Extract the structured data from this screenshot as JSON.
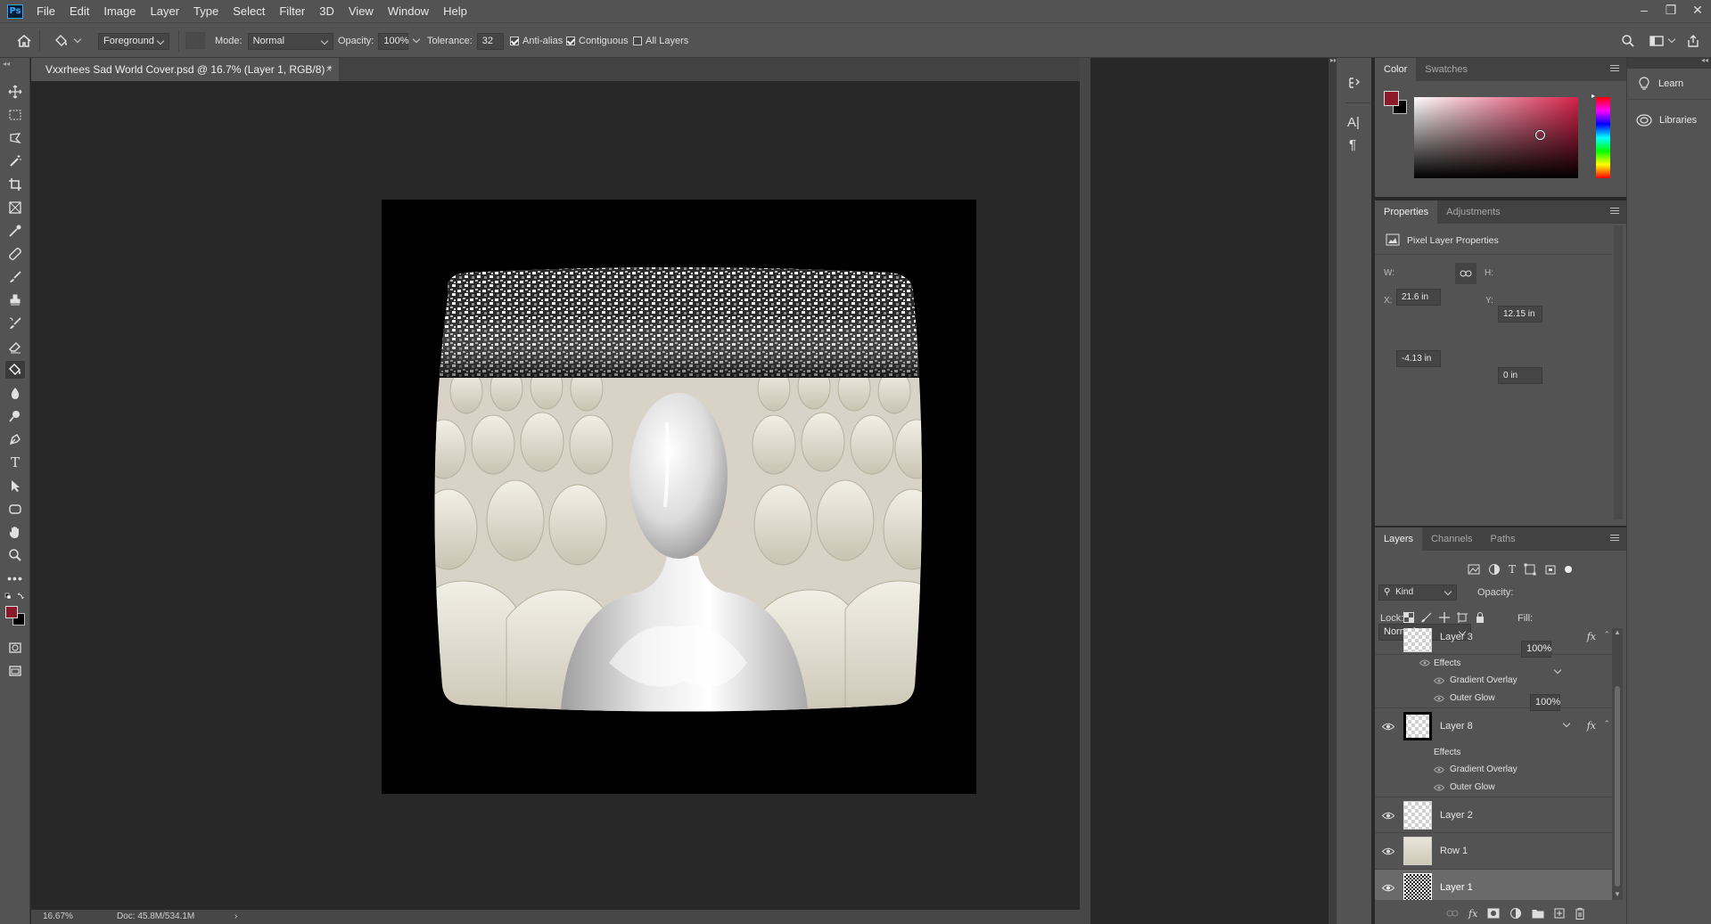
{
  "app": {
    "logo": "Ps"
  },
  "menu": [
    "File",
    "Edit",
    "Image",
    "Layer",
    "Type",
    "Select",
    "Filter",
    "3D",
    "View",
    "Window",
    "Help"
  ],
  "options": {
    "fill_source": "Foreground",
    "mode_label": "Mode:",
    "mode_value": "Normal",
    "opacity_label": "Opacity:",
    "opacity_value": "100%",
    "tolerance_label": "Tolerance:",
    "tolerance_value": "32",
    "antialias_label": "Anti-alias",
    "antialias_checked": true,
    "contiguous_label": "Contiguous",
    "contiguous_checked": true,
    "all_layers_label": "All Layers",
    "all_layers_checked": false
  },
  "document": {
    "tab_title": "Vxxrhees Sad World Cover.psd @ 16.7% (Layer 1, RGB/8) *",
    "close_glyph": "×"
  },
  "status": {
    "zoom": "16.67%",
    "doc_info": "Doc: 45.8M/534.1M",
    "arrow": "›"
  },
  "color_panel": {
    "tabs": [
      "Color",
      "Swatches"
    ],
    "active_tab": 0,
    "foreground": "#8b1a2a",
    "background": "#000000",
    "hue": "#d6224a"
  },
  "properties_panel": {
    "tabs": [
      "Properties",
      "Adjustments"
    ],
    "active_tab": 0,
    "kind": "Pixel Layer Properties",
    "w_label": "W:",
    "w_value": "21.6 in",
    "h_label": "H:",
    "h_value": "12.15 in",
    "x_label": "X:",
    "x_value": "-4.13 in",
    "y_label": "Y:",
    "y_value": "0 in"
  },
  "layers_panel": {
    "tabs": [
      "Layers",
      "Channels",
      "Paths"
    ],
    "active_tab": 0,
    "filter_value": "Kind",
    "blend_mode": "Normal",
    "opacity_label": "Opacity:",
    "opacity_value": "100%",
    "lock_label": "Lock:",
    "fill_label": "Fill:",
    "fill_value": "100%",
    "fx_glyph": "fx",
    "layer3": {
      "name": "Layer 3",
      "effects_label": "Effects",
      "effects": [
        "Gradient Overlay",
        "Outer Glow"
      ],
      "visible": false
    },
    "layer8": {
      "name": "Layer 8",
      "effects_label": "Effects",
      "effects": [
        "Gradient Overlay",
        "Outer Glow"
      ],
      "visible": true
    },
    "layers": [
      {
        "name": "Layer 2",
        "visible": true
      },
      {
        "name": "Row 1",
        "visible": true
      },
      {
        "name": "Layer 1",
        "visible": true,
        "selected": true
      }
    ]
  },
  "right_dock": {
    "learn_label": "Learn",
    "libraries_label": "Libraries"
  }
}
